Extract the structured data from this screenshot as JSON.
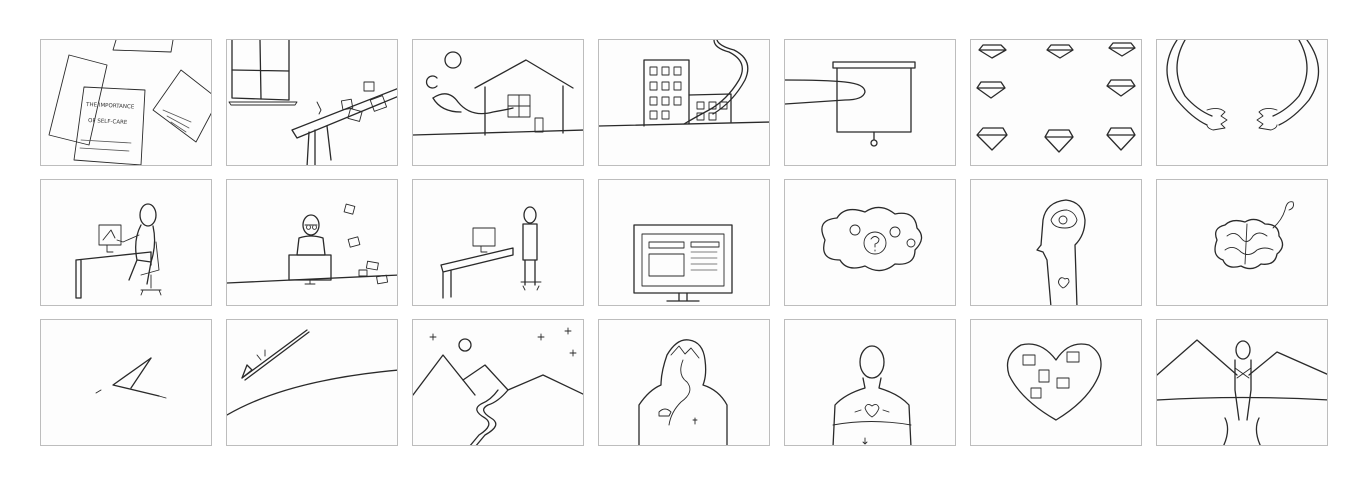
{
  "storyboard": {
    "panel_1": {
      "document_text_line_1": "THE IMPORTANCE",
      "document_text_line_2": "OF SELF-CARE"
    }
  }
}
